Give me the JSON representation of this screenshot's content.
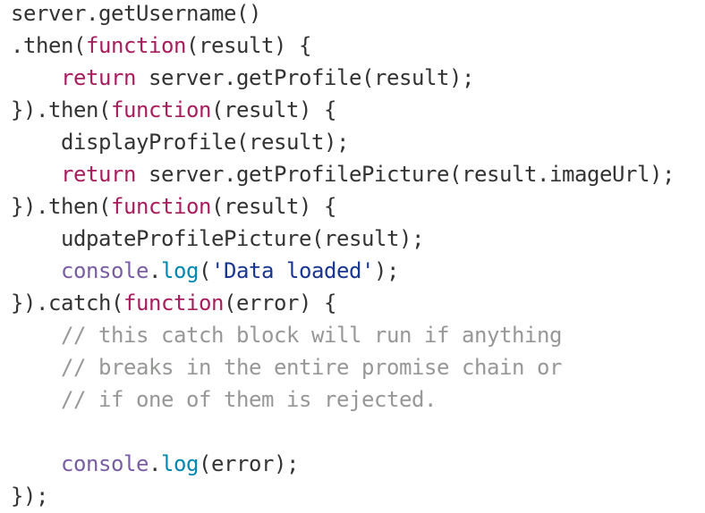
{
  "colors": {
    "text": "#333333",
    "keyword": "#a71d5d",
    "builtin": "#795da3",
    "method": "#0086b3",
    "string": "#183691",
    "comment": "#969896",
    "background": "#ffffff"
  },
  "code": {
    "lines": [
      [
        {
          "t": "server.getUsername()",
          "k": "plain"
        }
      ],
      [
        {
          "t": ".then(",
          "k": "plain"
        },
        {
          "t": "function",
          "k": "keyword"
        },
        {
          "t": "(result) {",
          "k": "plain"
        }
      ],
      [
        {
          "t": "    ",
          "k": "plain"
        },
        {
          "t": "return",
          "k": "keyword"
        },
        {
          "t": " server.getProfile(result);",
          "k": "plain"
        }
      ],
      [
        {
          "t": "}).then(",
          "k": "plain"
        },
        {
          "t": "function",
          "k": "keyword"
        },
        {
          "t": "(result) {",
          "k": "plain"
        }
      ],
      [
        {
          "t": "    displayProfile(result);",
          "k": "plain"
        }
      ],
      [
        {
          "t": "    ",
          "k": "plain"
        },
        {
          "t": "return",
          "k": "keyword"
        },
        {
          "t": " server.getProfilePicture(result.imageUrl);",
          "k": "plain"
        }
      ],
      [
        {
          "t": "}).then(",
          "k": "plain"
        },
        {
          "t": "function",
          "k": "keyword"
        },
        {
          "t": "(result) {",
          "k": "plain"
        }
      ],
      [
        {
          "t": "    udpateProfilePicture(result);",
          "k": "plain"
        }
      ],
      [
        {
          "t": "    ",
          "k": "plain"
        },
        {
          "t": "console",
          "k": "builtin"
        },
        {
          "t": ".",
          "k": "plain"
        },
        {
          "t": "log",
          "k": "method"
        },
        {
          "t": "(",
          "k": "plain"
        },
        {
          "t": "'Data loaded'",
          "k": "string"
        },
        {
          "t": ");",
          "k": "plain"
        }
      ],
      [
        {
          "t": "}).catch(",
          "k": "plain"
        },
        {
          "t": "function",
          "k": "keyword"
        },
        {
          "t": "(error) {",
          "k": "plain"
        }
      ],
      [
        {
          "t": "    ",
          "k": "plain"
        },
        {
          "t": "// this catch block will run if anything",
          "k": "comment"
        }
      ],
      [
        {
          "t": "    ",
          "k": "plain"
        },
        {
          "t": "// breaks in the entire promise chain or",
          "k": "comment"
        }
      ],
      [
        {
          "t": "    ",
          "k": "plain"
        },
        {
          "t": "// if one of them is rejected.",
          "k": "comment"
        }
      ],
      [
        {
          "t": "",
          "k": "plain"
        }
      ],
      [
        {
          "t": "    ",
          "k": "plain"
        },
        {
          "t": "console",
          "k": "builtin"
        },
        {
          "t": ".",
          "k": "plain"
        },
        {
          "t": "log",
          "k": "method"
        },
        {
          "t": "(error);",
          "k": "plain"
        }
      ],
      [
        {
          "t": "});",
          "k": "plain"
        }
      ]
    ]
  }
}
